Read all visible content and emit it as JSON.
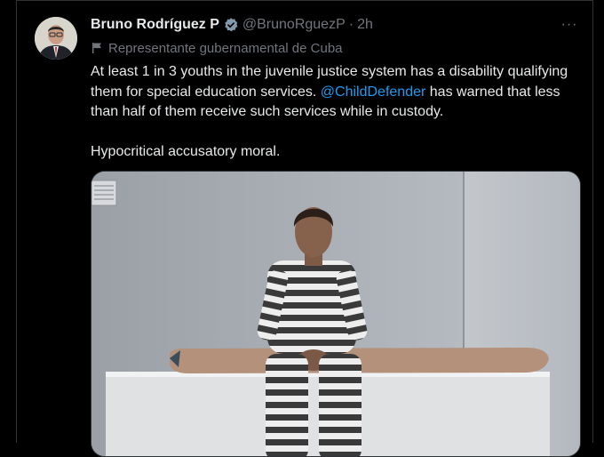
{
  "tweet": {
    "author_name": "Bruno Rodríguez P",
    "handle": "@BrunoRguezP",
    "separator": "·",
    "time": "2h",
    "affiliation_label": "Representante gubernamental de Cuba",
    "more_label": "···",
    "text_part1": "At least 1 in 3 youths in the juvenile justice system has a disability qualifying them for special education services. ",
    "mention": "@ChildDefender",
    "text_part2": " has warned that less than half of them receive such services while in custody.",
    "text_para2": "Hypocritical accusatory moral."
  },
  "colors": {
    "background": "#000000",
    "text_primary": "#e7e9ea",
    "text_secondary": "#71767b",
    "link": "#1d9bf0",
    "verified_badge": "#829aab",
    "border": "#2f3336"
  },
  "icons": {
    "verified": "verified-badge-icon",
    "affiliation": "flag-icon",
    "more": "more-options-icon"
  }
}
